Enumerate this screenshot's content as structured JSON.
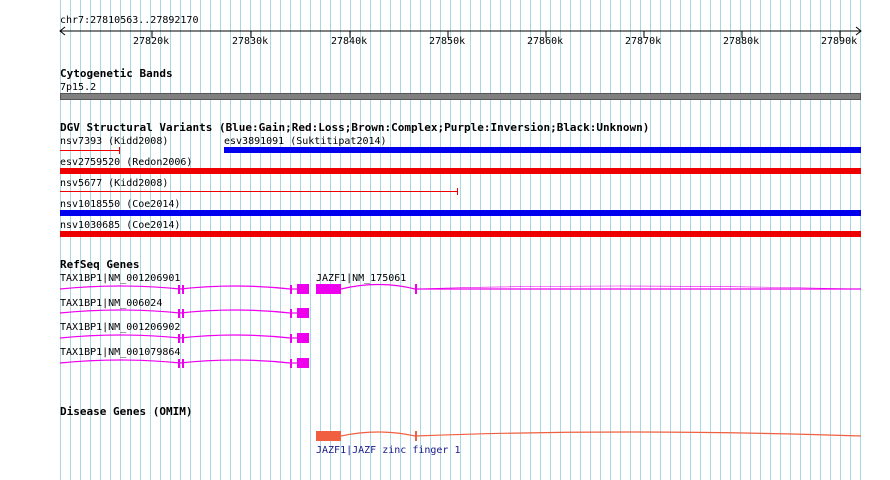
{
  "ruler": {
    "location": "chr7:27810563..27892170",
    "ticks": [
      "27820k",
      "27830k",
      "27840k",
      "27850k",
      "27860k",
      "27870k",
      "27880k",
      "27890k"
    ]
  },
  "tracks": {
    "cytoband": {
      "title": "Cytogenetic Bands",
      "band_label": "7p15.2",
      "band_color": "#808080"
    },
    "dgv": {
      "title": "DGV Structural Variants (Blue:Gain;Red:Loss;Brown:Complex;Purple:Inversion;Black:Unknown)",
      "colors": {
        "gain": "#0000ee",
        "loss": "#ee0000"
      },
      "features": [
        {
          "label": "nsv7393 (Kidd2008)",
          "type": "loss"
        },
        {
          "label": "esv3891091 (Suktitipat2014)",
          "type": "gain"
        },
        {
          "label": "esv2759520 (Redon2006)",
          "type": "loss"
        },
        {
          "label": "nsv5677 (Kidd2008)",
          "type": "loss"
        },
        {
          "label": "nsv1018550 (Coe2014)",
          "type": "gain"
        },
        {
          "label": "nsv1030685 (Coe2014)",
          "type": "loss"
        }
      ]
    },
    "refseq": {
      "title": "RefSeq Genes",
      "color": "#ee00ee",
      "genes": [
        {
          "label": "TAX1BP1|NM_001206901"
        },
        {
          "label": "JAZF1|NM_175061"
        },
        {
          "label": "TAX1BP1|NM_006024"
        },
        {
          "label": "TAX1BP1|NM_001206902"
        },
        {
          "label": "TAX1BP1|NM_001079864"
        }
      ]
    },
    "omim": {
      "title": "Disease Genes (OMIM)",
      "color": "#f06040",
      "label_color": "#1a1a8c",
      "genes": [
        {
          "label": "JAZF1|JAZF zinc finger 1"
        }
      ]
    }
  }
}
